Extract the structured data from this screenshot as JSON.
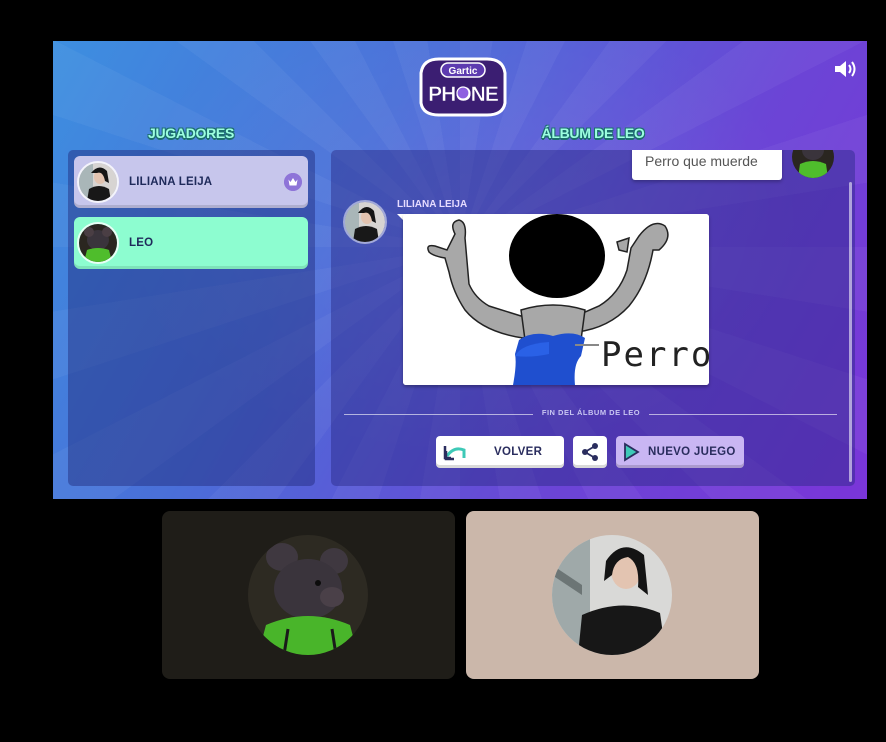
{
  "header": {
    "logo_top": "Gartic",
    "logo_bottom": "PHONE",
    "sound_icon": "speaker-volume-icon"
  },
  "players_panel": {
    "title": "JUGADORES",
    "players": [
      {
        "name": "LILIANA LEIJA",
        "host": true,
        "icon": "crown-icon"
      },
      {
        "name": "LEO",
        "host": false
      }
    ]
  },
  "album": {
    "title": "ÁLBUM DE LEO",
    "previous_message": "Perro que muerde",
    "drawing_author": "LILIANA LEIJA",
    "drawing_text": "Perro",
    "end_label": "FIN DEL ÁLBUM DE LEO",
    "buttons": {
      "back": "VOLVER",
      "share_icon": "share-icon",
      "new_game": "NUEVO JUEGO"
    }
  },
  "colors": {
    "accent_mint": "#8dfdd0",
    "host_row": "#c7c6ec",
    "new_game_button": "#c9b6f3"
  }
}
